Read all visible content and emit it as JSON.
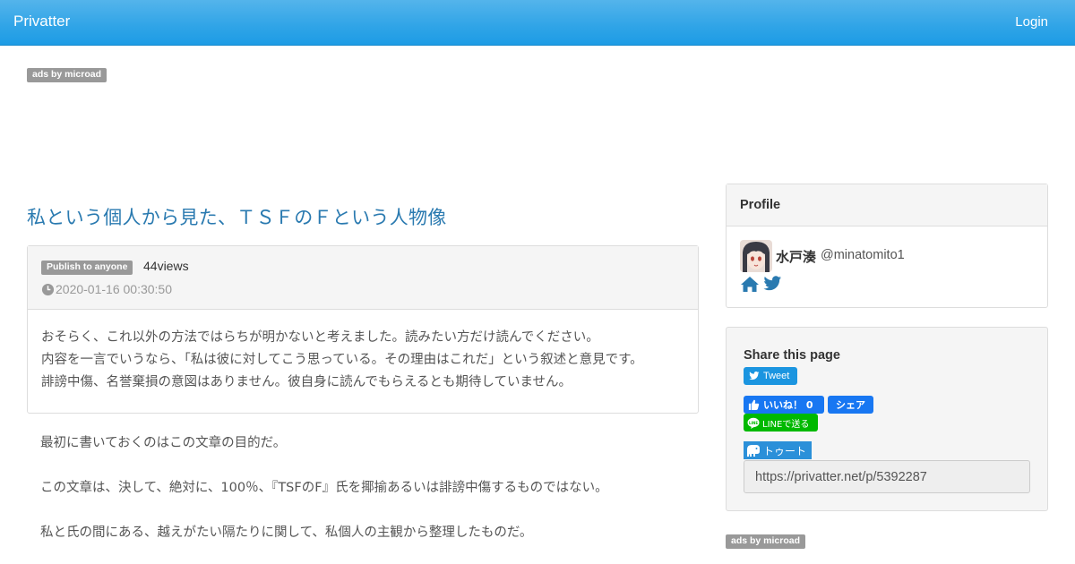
{
  "navbar": {
    "brand": "Privatter",
    "login": "Login"
  },
  "ads": {
    "top_label": "ads by microad",
    "side_label": "ads by microad"
  },
  "post": {
    "title": "私という個人から見た、ＴＳＦのＦという人物像",
    "visibility": "Publish to anyone",
    "views": "44views",
    "date": "2020-01-16 00:30:50",
    "intro": [
      "おそらく、これ以外の方法ではらちが明かないと考えました。読みたい方だけ読んでください。",
      "内容を一言でいうなら、「私は彼に対してこう思っている。その理由はこれだ」という叙述と意見です。",
      "誹謗中傷、名誉棄損の意図はありません。彼自身に読んでもらえるとも期待していません。"
    ],
    "body": [
      "最初に書いておくのはこの文章の目的だ。",
      "この文章は、決して、絶対に、100％、『TSFのF』氏を揶揄あるいは誹謗中傷するものではない。",
      "私と氏の間にある、越えがたい隔たりに関して、私個人の主観から整理したものだ。"
    ]
  },
  "profile": {
    "heading": "Profile",
    "name": "水戸湊",
    "handle": "@minatomito1",
    "icons": [
      "home-icon",
      "twitter-icon"
    ]
  },
  "share": {
    "heading": "Share this page",
    "tweet": "Tweet",
    "like": "いいね！ 0",
    "fb_share": "シェア",
    "line": "LINEで送る",
    "toot": "トゥート",
    "url": "https://privatter.net/p/5392287"
  },
  "colors": {
    "navbar": "#2fa4e7",
    "title_link": "#2a7ab0",
    "badge": "#999999",
    "twitter": "#1b95e0",
    "facebook": "#1877f2",
    "line": "#00b900",
    "mastodon": "#2b90d9"
  }
}
